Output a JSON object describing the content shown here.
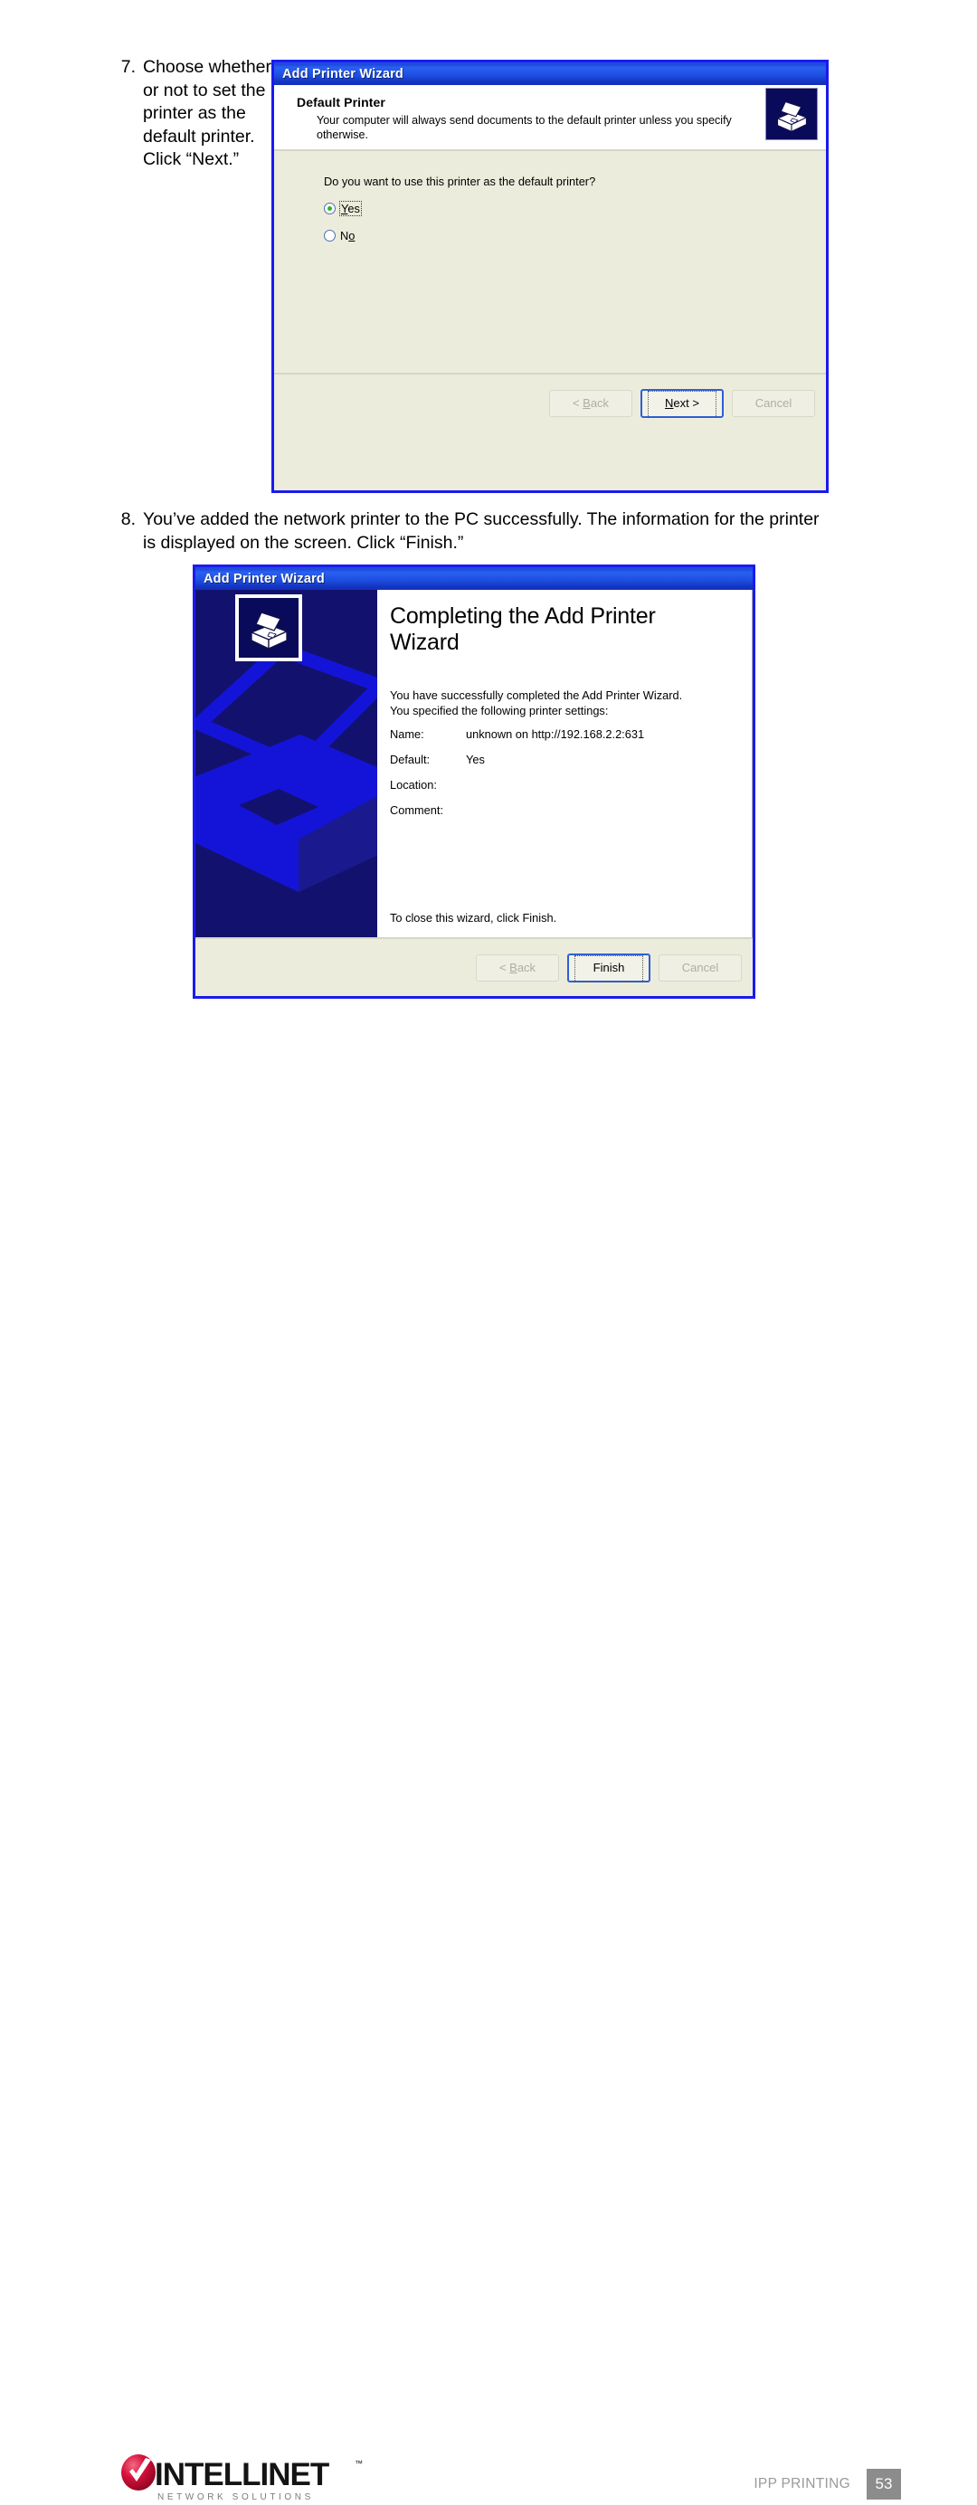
{
  "steps": [
    {
      "number": "7.",
      "text": "Choose whether or not to set the printer as the default printer. Click “Next.”"
    },
    {
      "number": "8.",
      "text": "You’ve added the network printer to the PC successfully. The information for the printer is displayed on the screen. Click “Finish.”"
    }
  ],
  "dialog_default_printer": {
    "title": "Add Printer Wizard",
    "heading": "Default Printer",
    "description": "Your computer will always send documents to the default printer unless you specify otherwise.",
    "question": "Do you want to use this printer as the default printer?",
    "options": [
      {
        "label": "Yes",
        "selected": true
      },
      {
        "label": "No",
        "selected": false
      }
    ],
    "buttons": {
      "back": "< Back",
      "next": "Next >",
      "cancel": "Cancel"
    },
    "icon": "printer-icon"
  },
  "dialog_completing": {
    "title": "Add Printer Wizard",
    "heading": "Completing the Add Printer Wizard",
    "intro_line1": "You have successfully completed the Add Printer Wizard.",
    "intro_line2": "You specified the following printer settings:",
    "settings": [
      {
        "key": "Name:",
        "value": "unknown on http://192.168.2.2:631"
      },
      {
        "key": "Default:",
        "value": "Yes"
      },
      {
        "key": "Location:",
        "value": ""
      },
      {
        "key": "Comment:",
        "value": ""
      }
    ],
    "closing": "To close this wizard, click Finish.",
    "buttons": {
      "back": "< Back",
      "finish": "Finish",
      "cancel": "Cancel"
    },
    "icon": "printer-icon"
  },
  "footer": {
    "brand": "INTELLINET",
    "tagline": "N E T W O R K   S O L U T I O N S",
    "section": "IPP PRINTING",
    "page": "53"
  },
  "colors": {
    "titlebar_blue": "#1F4FE0",
    "dialog_border": "#1A1AEE",
    "dialog_face": "#ECECDC",
    "sidebar_navy": "#12126E",
    "sidebar_accent": "#1414D8",
    "radio_green": "#2BB52B",
    "page_badge_gray": "#8C8C8C",
    "footer_gray": "#9A9A9A",
    "logo_red": "#D8123C"
  }
}
